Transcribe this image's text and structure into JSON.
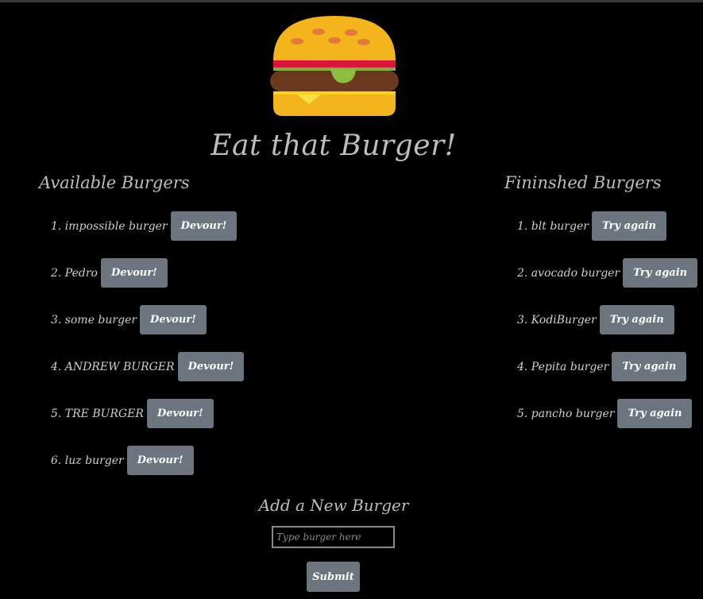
{
  "header": {
    "title": "Eat that Burger!",
    "logo_icon": "hamburger-icon"
  },
  "available": {
    "title": "Available Burgers",
    "items": [
      {
        "label": "1. impossible burger",
        "button": "Devour!"
      },
      {
        "label": "2. Pedro",
        "button": "Devour!"
      },
      {
        "label": "3. some burger",
        "button": "Devour!"
      },
      {
        "label": "4. ANDREW BURGER",
        "button": "Devour!"
      },
      {
        "label": "5. TRE BURGER",
        "button": "Devour!"
      },
      {
        "label": "6. luz burger",
        "button": "Devour!"
      }
    ]
  },
  "finished": {
    "title": "Fininshed Burgers",
    "items": [
      {
        "label": "1. blt burger",
        "button": "Try again"
      },
      {
        "label": "2. avocado burger",
        "button": "Try again"
      },
      {
        "label": "3. KodiBurger",
        "button": "Try again"
      },
      {
        "label": "4. Pepita burger",
        "button": "Try again"
      },
      {
        "label": "5. pancho burger",
        "button": "Try again"
      }
    ]
  },
  "add_form": {
    "title": "Add a New Burger",
    "placeholder": "Type burger here",
    "value": "",
    "submit_label": "Submit"
  },
  "colors": {
    "background": "#000000",
    "button": "#6c757d",
    "text": "#cfcfcf"
  }
}
